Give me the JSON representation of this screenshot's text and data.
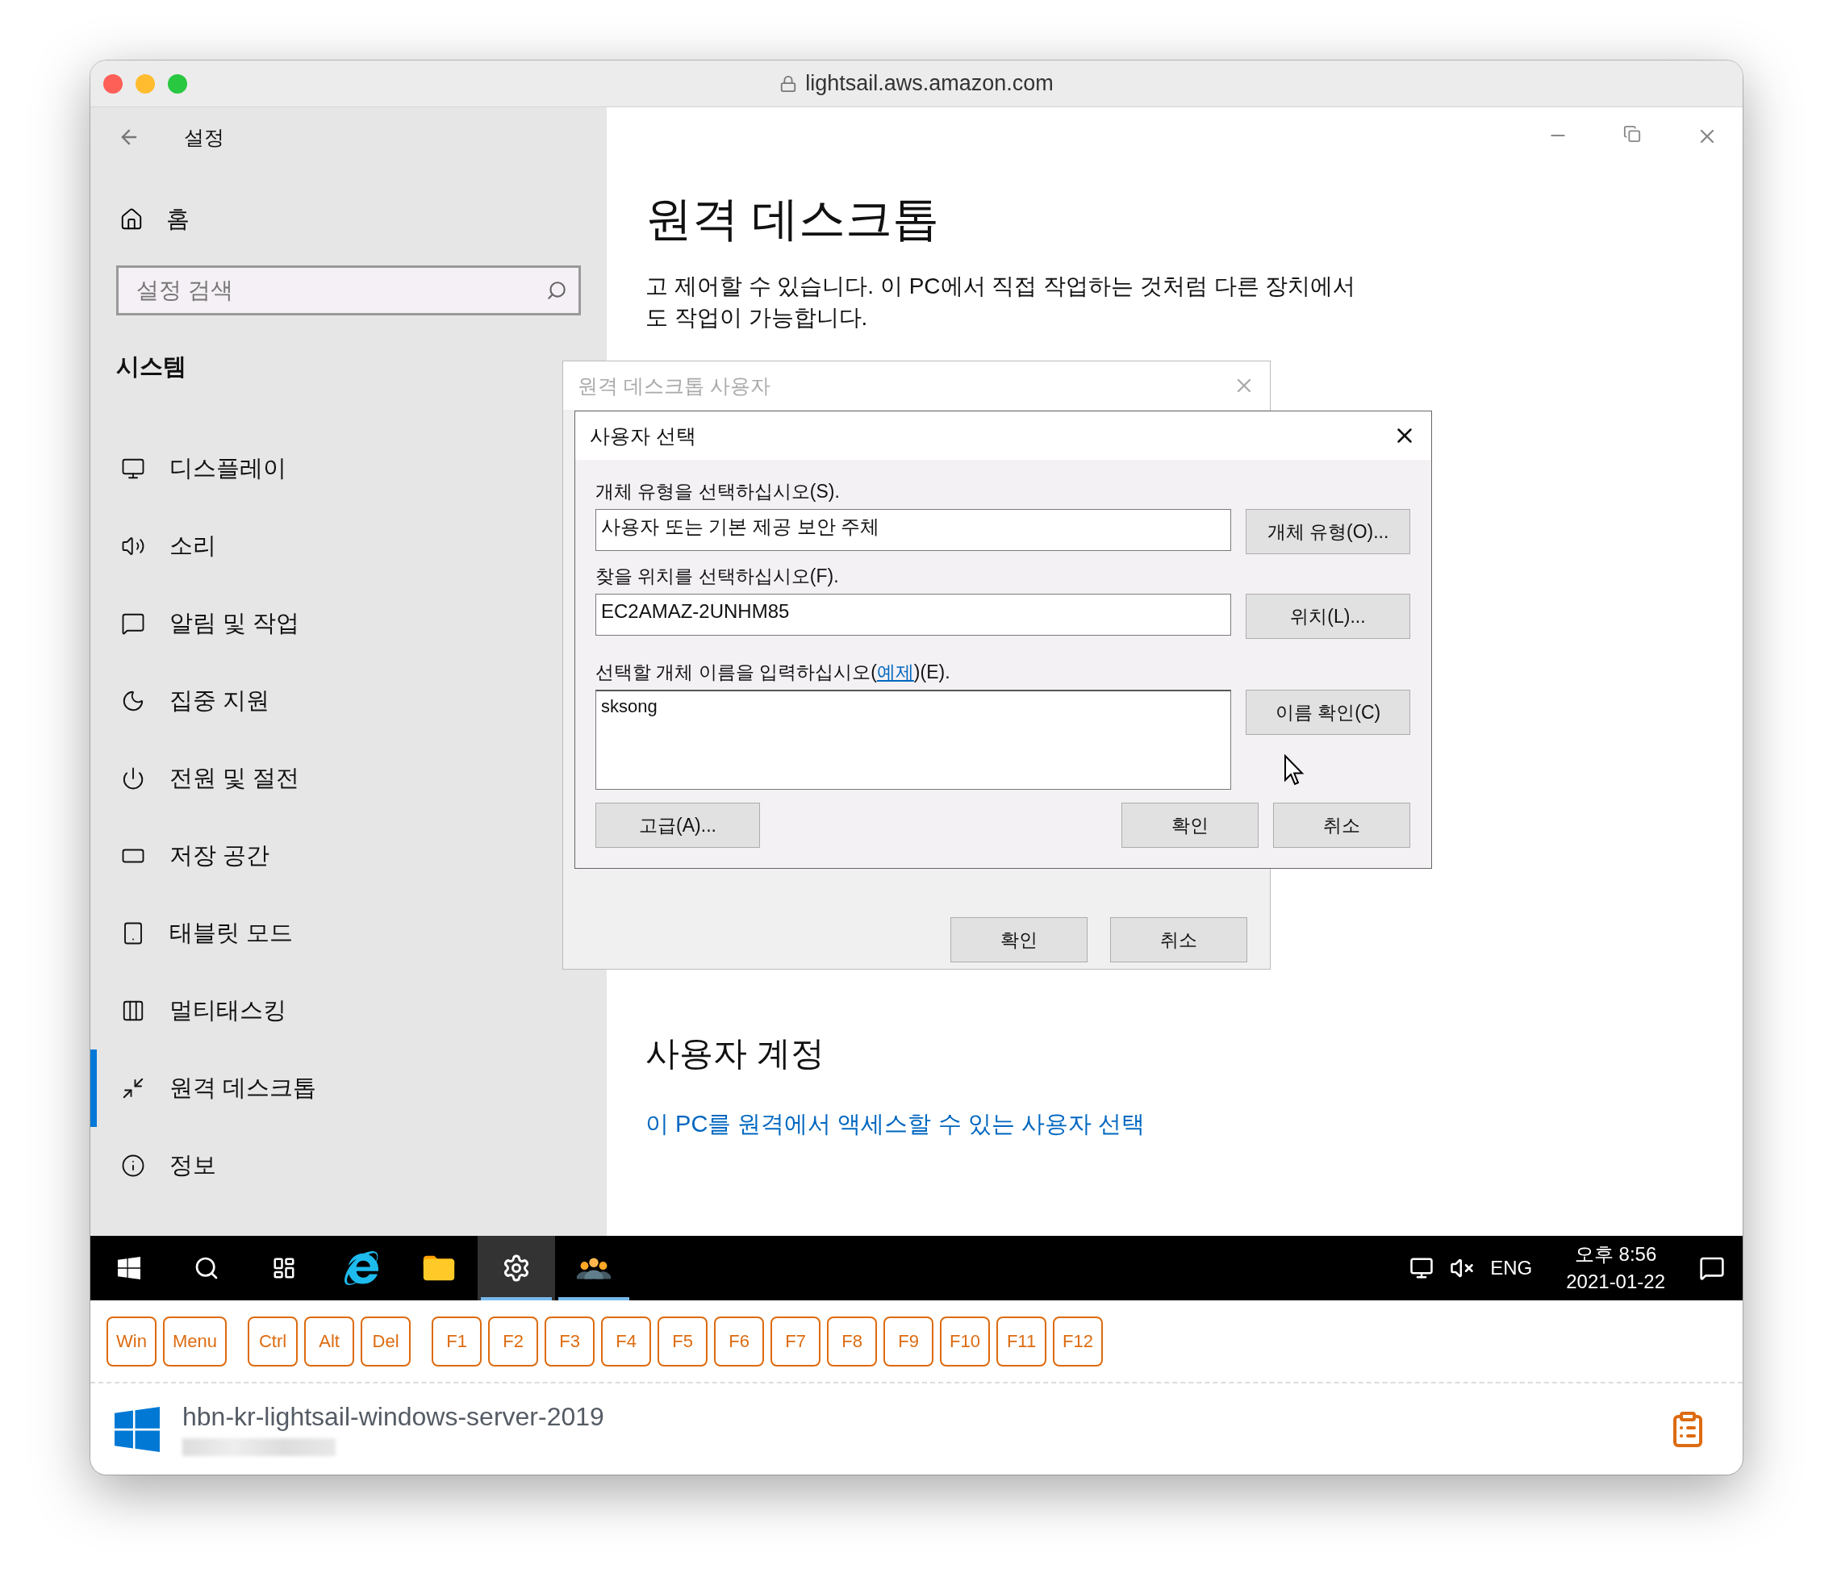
{
  "browser": {
    "url": "lightsail.aws.amazon.com"
  },
  "settings": {
    "title": "설정",
    "home": "홈",
    "search_placeholder": "설정 검색",
    "section": "시스템",
    "nav": [
      {
        "label": "디스플레이",
        "selected": false
      },
      {
        "label": "소리",
        "selected": false
      },
      {
        "label": "알림 및 작업",
        "selected": false
      },
      {
        "label": "집중 지원",
        "selected": false
      },
      {
        "label": "전원 및 절전",
        "selected": false
      },
      {
        "label": "저장 공간",
        "selected": false
      },
      {
        "label": "태블릿 모드",
        "selected": false
      },
      {
        "label": "멀티태스킹",
        "selected": false
      },
      {
        "label": "원격 데스크톱",
        "selected": true
      },
      {
        "label": "정보",
        "selected": false
      }
    ],
    "page_title": "원격 데스크톱",
    "description": "고 제어할 수 있습니다. 이 PC에서 직접 작업하는 것처럼 다른 장치에서 도 작업이 가능합니다.",
    "section_heading": "사용자 계정",
    "link": "이 PC를 원격에서 액세스할 수 있는 사용자 선택"
  },
  "users_dialog": {
    "title": "원격 데스크톱 사용자",
    "buttons": [
      "확인",
      "취소"
    ]
  },
  "select_dialog": {
    "title": "사용자 선택",
    "type_label": "개체 유형을 선택하십시오(S).",
    "type_value": "사용자 또는 기본 제공 보안 주체",
    "type_button": "개체 유형(O)...",
    "location_label": "찾을 위치를 선택하십시오(F).",
    "location_value": "EC2AMAZ-2UNHM85",
    "location_button": "위치(L)...",
    "name_label": "선택할 개체 이름을 입력하십시오(",
    "name_label_link": "예제",
    "name_label_end": ")(E).",
    "name_value": "sksong",
    "check_button": "이름 확인(C)",
    "advanced_button": "고급(A)...",
    "buttons": [
      "확인",
      "취소"
    ]
  },
  "taskbar": {
    "items": [
      {
        "kind": "start"
      },
      {
        "kind": "search"
      },
      {
        "kind": "taskview"
      },
      {
        "kind": "browser",
        "running": false,
        "selected": false
      },
      {
        "kind": "folder",
        "running": false,
        "selected": false
      },
      {
        "kind": "settings",
        "running": true,
        "selected": true
      },
      {
        "kind": "users",
        "running": true,
        "selected": false
      }
    ],
    "language": "ENG",
    "time": "오후 8:56",
    "date": "2021-01-22"
  },
  "keys": [
    [
      "Win",
      "Menu"
    ],
    [
      "Ctrl",
      "Alt",
      "Del"
    ],
    [
      "F1",
      "F2",
      "F3",
      "F4",
      "F5",
      "F6",
      "F7",
      "F8",
      "F9",
      "F10",
      "F11",
      "F12"
    ]
  ],
  "footer": {
    "instance": "hbn-kr-lightsail-windows-server-2019"
  }
}
